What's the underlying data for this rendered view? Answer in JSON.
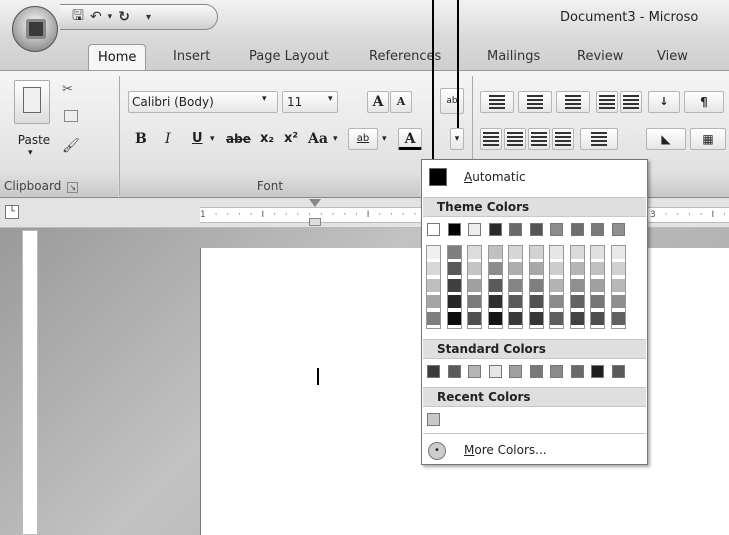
{
  "window": {
    "title": "Document3 - Microso"
  },
  "tabs": [
    "Home",
    "Insert",
    "Page Layout",
    "References",
    "Mailings",
    "Review",
    "View"
  ],
  "clipboard": {
    "paste": "Paste",
    "group": "Clipboard"
  },
  "font": {
    "name": "Calibri (Body)",
    "size": "11",
    "group": "Font",
    "bold": "B",
    "italic": "I",
    "underline": "U",
    "strike": "abe",
    "sub": "x₂",
    "sup": "x²",
    "case": "Aa",
    "grow": "A",
    "shrink": "A",
    "color_letter": "A",
    "highlight": "ab"
  },
  "ruler": {
    "marks": "1 · · · · I · · · · · · · · I · · · ·",
    "mark3": "3 · · · · I ·"
  },
  "color_menu": {
    "automatic": {
      "prefix": "",
      "underlined": "A",
      "rest": "utomatic"
    },
    "theme_header": "Theme Colors",
    "standard_header": "Standard Colors",
    "recent_header": "Recent Colors",
    "more": {
      "underlined": "M",
      "rest": "ore Colors..."
    },
    "theme_top": [
      "#ffffff",
      "#000000",
      "#eeeeee",
      "#2b2b2b",
      "#6a6a6a",
      "#555555",
      "#8c8c8c",
      "#6e6e6e",
      "#7a7a7a",
      "#909090"
    ],
    "theme_shades": [
      [
        "#f0f0f0",
        "#d8d8d8",
        "#bfbfbf",
        "#a5a5a5",
        "#7f7f7f"
      ],
      [
        "#7f7f7f",
        "#595959",
        "#404040",
        "#262626",
        "#0d0d0d"
      ],
      [
        "#dcdcdc",
        "#c4c4c4",
        "#a0a0a0",
        "#7a7a7a",
        "#505050"
      ],
      [
        "#c0c0c0",
        "#8c8c8c",
        "#5a5a5a",
        "#2e2e2e",
        "#141414"
      ],
      [
        "#d6d6d6",
        "#adadad",
        "#858585",
        "#5a5a5a",
        "#3a3a3a"
      ],
      [
        "#d2d2d2",
        "#a8a8a8",
        "#7e7e7e",
        "#525252",
        "#363636"
      ],
      [
        "#e6e6e6",
        "#cdcdcd",
        "#b3b3b3",
        "#8a8a8a",
        "#5e5e5e"
      ],
      [
        "#dadada",
        "#b5b5b5",
        "#8f8f8f",
        "#636363",
        "#424242"
      ],
      [
        "#e0e0e0",
        "#c0c0c0",
        "#a0a0a0",
        "#767676",
        "#4e4e4e"
      ],
      [
        "#e8e8e8",
        "#d0d0d0",
        "#b8b8b8",
        "#8e8e8e",
        "#606060"
      ]
    ],
    "standard": [
      "#3a3a3a",
      "#5a5a5a",
      "#b4b4b4",
      "#e6e6e6",
      "#a0a0a0",
      "#787878",
      "#8a8a8a",
      "#6a6a6a",
      "#1e1e1e",
      "#5a5a5a"
    ],
    "recent": [
      "#c8c8c8"
    ]
  }
}
